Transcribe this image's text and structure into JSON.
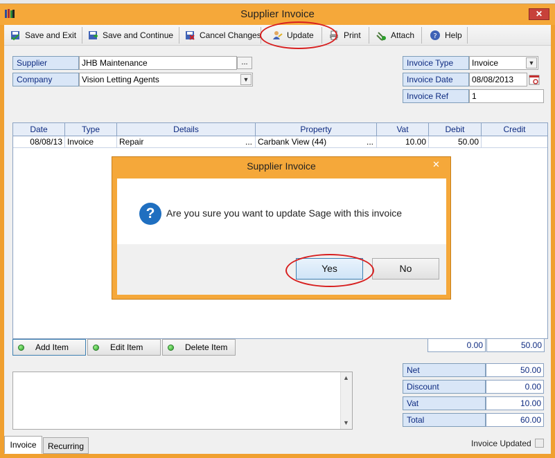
{
  "window": {
    "title": "Supplier Invoice",
    "close_glyph": "✕"
  },
  "toolbar": {
    "save_exit": "Save and Exit",
    "save_continue": "Save and Continue",
    "cancel_changes": "Cancel Changes",
    "update": "Update",
    "print": "Print",
    "attach": "Attach",
    "help": "Help"
  },
  "form": {
    "supplier_label": "Supplier",
    "supplier_value": "JHB Maintenance",
    "company_label": "Company",
    "company_value": "Vision Letting Agents",
    "invoice_type_label": "Invoice Type",
    "invoice_type_value": "Invoice",
    "invoice_date_label": "Invoice Date",
    "invoice_date_value": "08/08/2013",
    "invoice_ref_label": "Invoice Ref",
    "invoice_ref_value": "1",
    "ellipsis": "..."
  },
  "grid": {
    "columns": [
      "Date",
      "Type",
      "Details",
      "Property",
      "Vat",
      "Debit",
      "Credit"
    ],
    "rows": [
      {
        "date": "08/08/13",
        "type": "Invoice",
        "details": "Repair",
        "details_more": "...",
        "property": "Carbank View (44)",
        "property_more": "...",
        "vat": "10.00",
        "debit": "50.00",
        "credit": ""
      }
    ]
  },
  "items": {
    "add": "Add Item",
    "edit": "Edit Item",
    "delete": "Delete Item"
  },
  "totals_row": {
    "debit_total": "0.00",
    "credit_total": "50.00"
  },
  "summary": [
    {
      "label": "Net",
      "value": "50.00"
    },
    {
      "label": "Discount",
      "value": "0.00"
    },
    {
      "label": "Vat",
      "value": "10.00"
    },
    {
      "label": "Total",
      "value": "60.00"
    }
  ],
  "tabs": {
    "invoice": "Invoice",
    "recurring": "Recurring"
  },
  "status": {
    "invoice_updated": "Invoice Updated"
  },
  "dialog": {
    "title": "Supplier Invoice",
    "message": "Are you sure you want to update Sage with this invoice",
    "yes": "Yes",
    "no": "No",
    "icon_glyph": "?"
  },
  "colors": {
    "frame": "#f5a83a",
    "label_bg": "#d9e6f7",
    "label_text": "#0d2a80",
    "highlight_ring": "#d71e1e"
  }
}
